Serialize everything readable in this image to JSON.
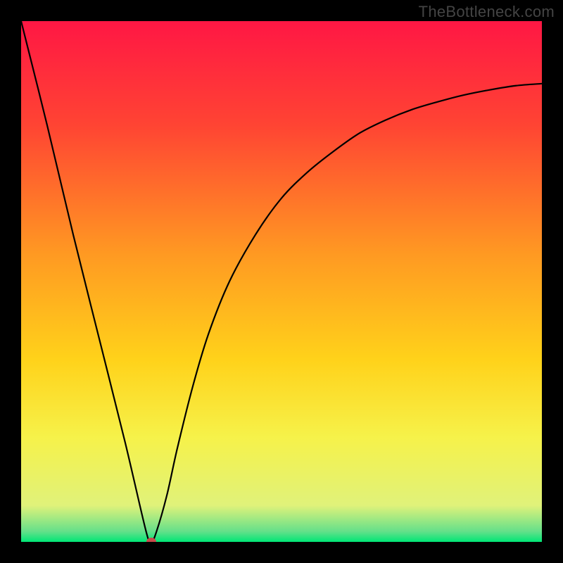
{
  "watermark": "TheBottleneck.com",
  "chart_data": {
    "type": "line",
    "title": "",
    "xlabel": "",
    "ylabel": "",
    "xlim": [
      0,
      100
    ],
    "ylim": [
      0,
      100
    ],
    "grid": false,
    "legend": false,
    "background_gradient": {
      "orientation": "vertical",
      "stops": [
        {
          "pos": 0.0,
          "color": "#ff1744"
        },
        {
          "pos": 0.2,
          "color": "#ff4433"
        },
        {
          "pos": 0.45,
          "color": "#ff9a22"
        },
        {
          "pos": 0.65,
          "color": "#ffd21a"
        },
        {
          "pos": 0.8,
          "color": "#f6f24a"
        },
        {
          "pos": 0.93,
          "color": "#e0f27a"
        },
        {
          "pos": 0.98,
          "color": "#64e08a"
        },
        {
          "pos": 1.0,
          "color": "#00e676"
        }
      ]
    },
    "series": [
      {
        "name": "bottleneck-curve",
        "color": "#000000",
        "x": [
          0,
          5,
          10,
          15,
          20,
          24,
          25,
          26,
          28,
          30,
          33,
          36,
          40,
          45,
          50,
          55,
          60,
          65,
          70,
          75,
          80,
          85,
          90,
          95,
          100
        ],
        "y": [
          100,
          80,
          59,
          39,
          19,
          2,
          0,
          2,
          9,
          18,
          30,
          40,
          50,
          59,
          66,
          71,
          75,
          78.5,
          81,
          83,
          84.5,
          85.8,
          86.8,
          87.6,
          88
        ]
      }
    ],
    "marker": {
      "name": "optimum-point",
      "x": 25,
      "y": 0,
      "color": "#c84a4a",
      "radius": 6
    }
  }
}
